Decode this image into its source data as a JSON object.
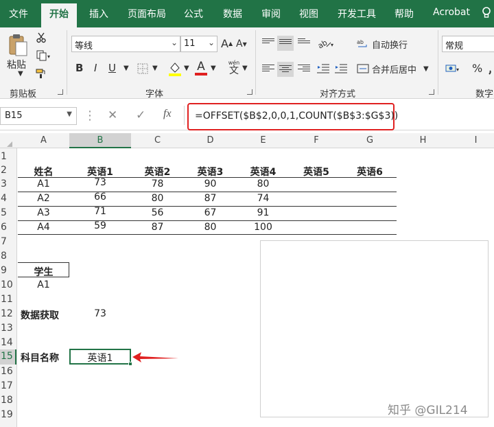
{
  "ribbon_tabs": [
    "文件",
    "开始",
    "插入",
    "页面布局",
    "公式",
    "数据",
    "审阅",
    "视图",
    "开发工具",
    "帮助",
    "Acrobat"
  ],
  "clipboard": {
    "paste_label": "粘贴",
    "group_label": "剪贴板"
  },
  "font": {
    "name": "等线",
    "size": "11",
    "group_label": "字体",
    "grow_label": "A",
    "shrink_label": "A",
    "bold": "B",
    "italic": "I",
    "underline": "U",
    "font_color": "A",
    "phonetic_top": "wén",
    "phonetic_bottom": "文"
  },
  "alignment": {
    "wrap_label": "自动换行",
    "merge_label": "合并后居中",
    "group_label": "对齐方式"
  },
  "number": {
    "format": "常规",
    "group_label": "数字",
    "percent": "%"
  },
  "formula_bar": {
    "name_box": "B15",
    "cancel": "✕",
    "confirm": "✓",
    "fx": "fx",
    "formula": "=OFFSET($B$2,0,0,1,COUNT($B$3:$G$3))"
  },
  "columns": [
    "A",
    "B",
    "C",
    "D",
    "E",
    "F",
    "G",
    "H",
    "I"
  ],
  "rows": [
    "1",
    "2",
    "3",
    "4",
    "5",
    "6",
    "7",
    "8",
    "9",
    "10",
    "11",
    "12",
    "13",
    "14",
    "15",
    "16",
    "17",
    "18",
    "19"
  ],
  "table": {
    "headers": [
      "姓名",
      "英语1",
      "英语2",
      "英语3",
      "英语4",
      "英语5",
      "英语6"
    ],
    "rows": [
      [
        "A1",
        "73",
        "78",
        "90",
        "80"
      ],
      [
        "A2",
        "66",
        "80",
        "87",
        "74"
      ],
      [
        "A3",
        "71",
        "56",
        "67",
        "91"
      ],
      [
        "A4",
        "59",
        "87",
        "80",
        "100"
      ]
    ]
  },
  "student": {
    "label": "学生",
    "value": "A1"
  },
  "lookup": {
    "label": "数据获取",
    "value": "73"
  },
  "subject": {
    "label": "科目名称",
    "value": "英语1"
  },
  "watermark": "知乎 @GIL214",
  "colors": {
    "accent": "#217346",
    "highlight": "#e02020"
  }
}
